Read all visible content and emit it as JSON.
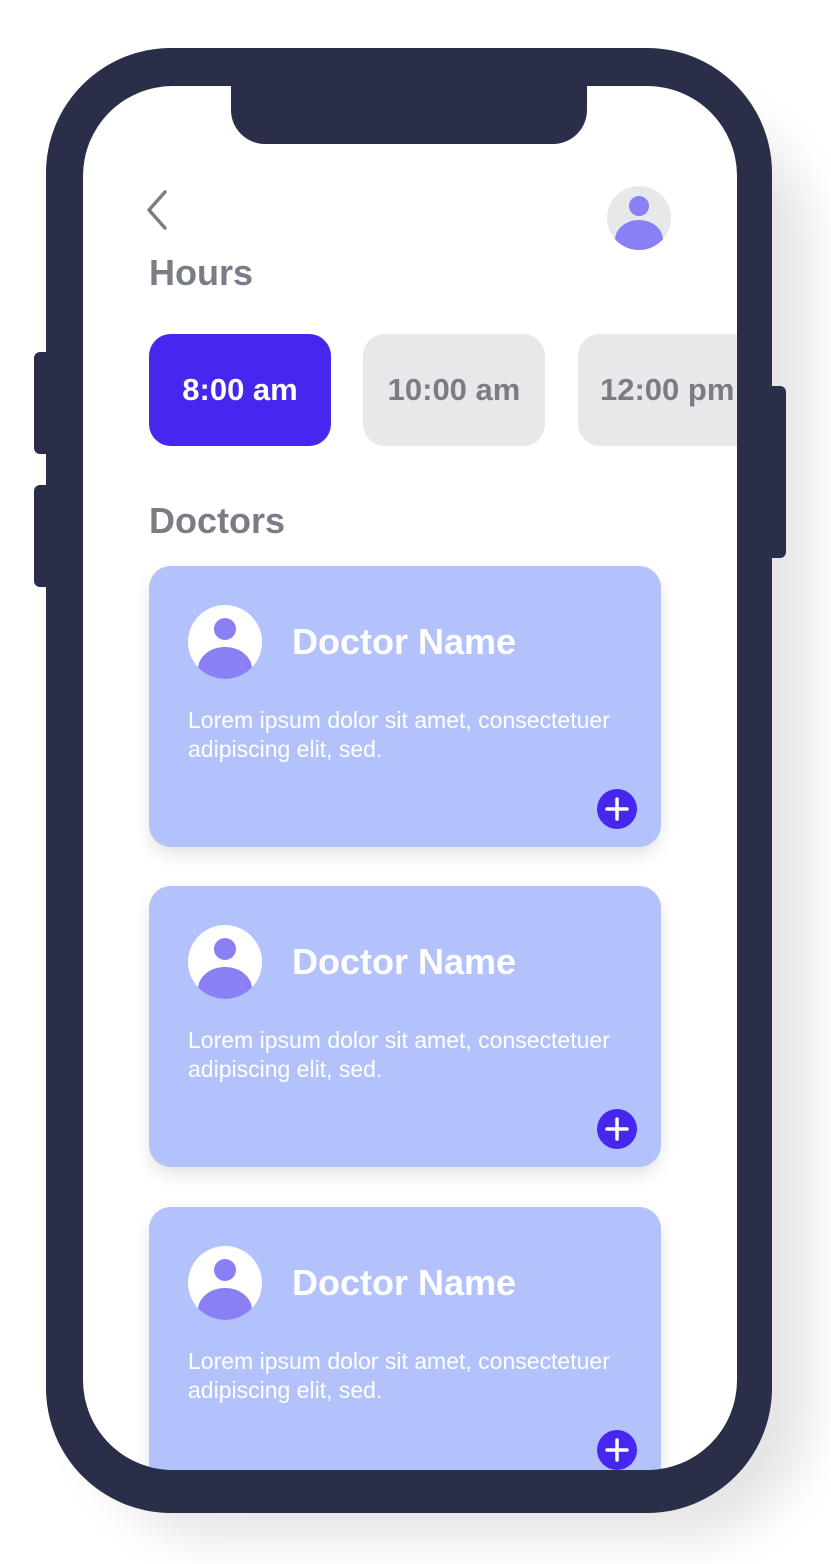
{
  "colors": {
    "phone_frame": "#2a2e49",
    "accent": "#4527ee",
    "card_bg": "#b3c2fb",
    "chip_bg": "#e8e8ea",
    "muted_text": "#7a7d86",
    "avatar_figure": "#8a7ff5"
  },
  "header": {
    "back_icon": "chevron-left-icon",
    "profile_icon": "user-icon"
  },
  "hours": {
    "title": "Hours",
    "slots": [
      {
        "label": "8:00 am",
        "selected": true
      },
      {
        "label": "10:00 am",
        "selected": false
      },
      {
        "label": "12:00 pm",
        "selected": false
      }
    ]
  },
  "doctors": {
    "title": "Doctors",
    "items": [
      {
        "name": "Doctor Name",
        "description": "Lorem ipsum dolor sit amet, consectetuer adipiscing elit, sed.",
        "add_icon": "plus-icon"
      },
      {
        "name": "Doctor Name",
        "description": "Lorem ipsum dolor sit amet, consectetuer adipiscing elit, sed.",
        "add_icon": "plus-icon"
      },
      {
        "name": "Doctor Name",
        "description": "Lorem ipsum dolor sit amet, consectetuer adipiscing elit, sed.",
        "add_icon": "plus-icon"
      }
    ]
  }
}
